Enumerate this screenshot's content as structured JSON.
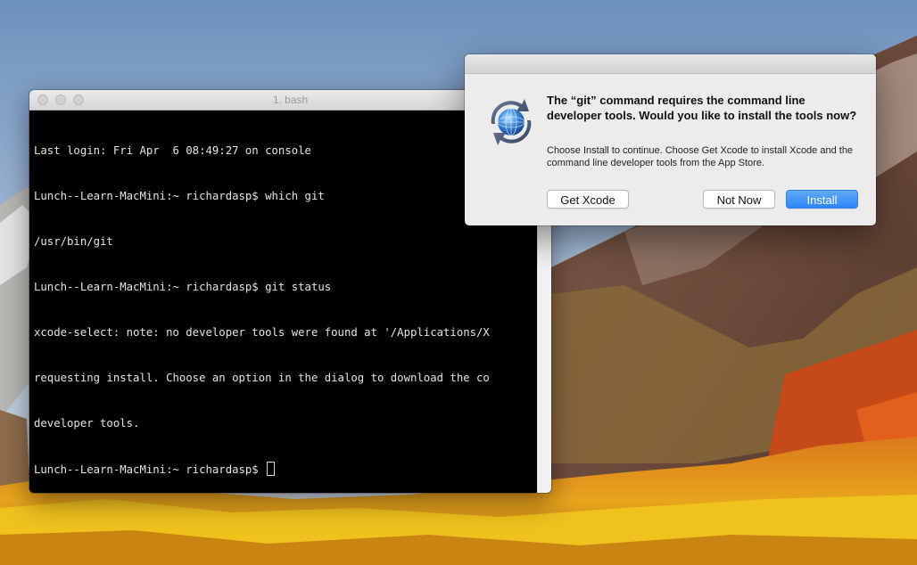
{
  "terminal": {
    "title": "1. bash",
    "lines": [
      "Last login: Fri Apr  6 08:49:27 on console",
      "Lunch--Learn-MacMini:~ richardasp$ which git",
      "/usr/bin/git",
      "Lunch--Learn-MacMini:~ richardasp$ git status",
      "xcode-select: note: no developer tools were found at '/Applications/X",
      "requesting install. Choose an option in the dialog to download the co",
      "developer tools."
    ],
    "prompt": "Lunch--Learn-MacMini:~ richardasp$ "
  },
  "dialog": {
    "icon": "software-update-globe-icon",
    "heading": "The “git” command requires the command line developer tools. Would you like to install the tools now?",
    "message": "Choose Install to continue. Choose Get Xcode to install Xcode and the command line developer tools from the App Store.",
    "buttons": {
      "get_xcode": "Get Xcode",
      "not_now": "Not Now",
      "install": "Install"
    }
  },
  "colors": {
    "install_button": "#2d86f7",
    "terminal_background": "#000000",
    "dialog_background": "#ececec"
  }
}
